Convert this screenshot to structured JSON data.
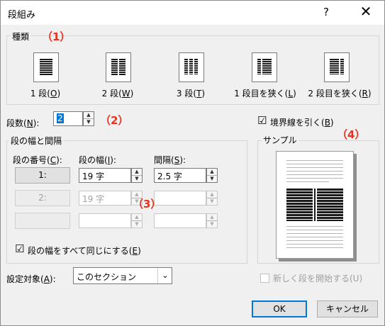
{
  "window": {
    "title": "段組み",
    "help": "?",
    "close": "✕"
  },
  "callouts": {
    "c1": "（1）",
    "c2": "（2）",
    "c3": "（3）",
    "c4": "（4）"
  },
  "presets": {
    "legend": "種類",
    "items": [
      {
        "label": "1 段(",
        "key": "O",
        "end": ")"
      },
      {
        "label": "2 段(",
        "key": "W",
        "end": ")"
      },
      {
        "label": "3 段(",
        "key": "T",
        "end": ")"
      },
      {
        "label": "1 段目を狭く(",
        "key": "L",
        "end": ")"
      },
      {
        "label": "2 段目を狭く(",
        "key": "R",
        "end": ")"
      }
    ]
  },
  "count": {
    "label": "段数(",
    "key": "N",
    "end": "):",
    "value": "2"
  },
  "widths": {
    "legend": "段の幅と間隔",
    "col_label": "段の番号(",
    "col_key": "C",
    "col_end": "):",
    "width_label": "段の幅(",
    "width_key": "I",
    "width_end": "):",
    "spacing_label": "間隔(",
    "spacing_key": "S",
    "spacing_end": "):",
    "rows": [
      {
        "num": "1:",
        "width": "19 字",
        "spacing": "2.5 字"
      },
      {
        "num": "2:",
        "width": "19 字",
        "spacing": ""
      },
      {
        "num": "",
        "width": "",
        "spacing": ""
      }
    ],
    "equal_label": "段の幅をすべて同じにする(",
    "equal_key": "E",
    "equal_end": ")",
    "equal_checked": "☑"
  },
  "line_between": {
    "label": "境界線を引く(",
    "key": "B",
    "end": ")",
    "checked": "☑"
  },
  "sample": {
    "legend": "サンプル"
  },
  "apply": {
    "label": "設定対象(",
    "key": "A",
    "end": "):",
    "value": "このセクション"
  },
  "new_column": {
    "label": "新しく段を開始する(U)"
  },
  "buttons": {
    "ok": "OK",
    "cancel": "キャンセル"
  }
}
